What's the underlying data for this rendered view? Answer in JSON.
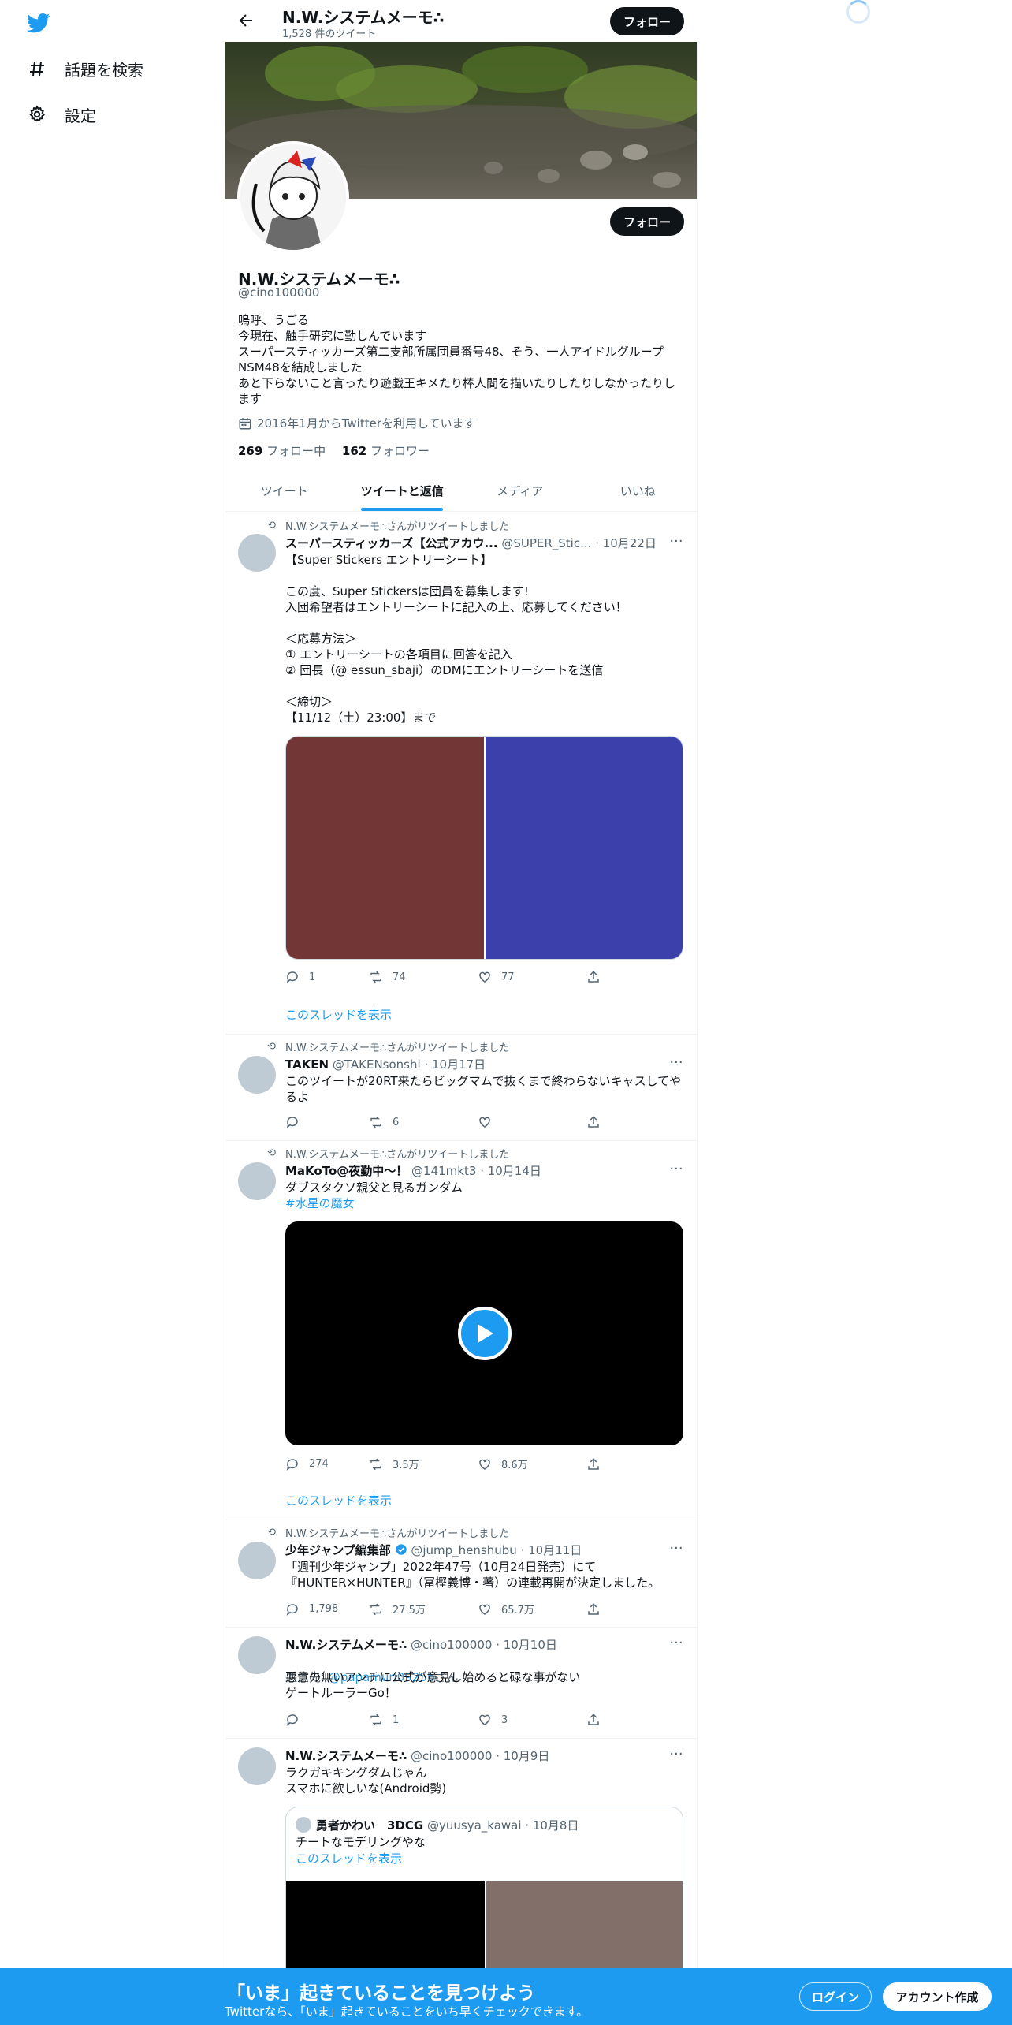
{
  "nav": {
    "explore_label": "話題を検索",
    "settings_label": "設定"
  },
  "header": {
    "name": "N.W.システムメーモ∴",
    "tweet_count": "1,528 件のツイート",
    "follow_label": "フォロー"
  },
  "profile": {
    "name": "N.W.システムメーモ∴",
    "handle": "@cino100000",
    "bio": [
      "嗚呼、うごる",
      "今現在、触手研究に勤しんでいます",
      "スーパースティッカーズ第二支部所属団員番号48、そう、一人アイドルグループNSM48を結成しました",
      "あと下らないこと言ったり遊戯王キメたり棒人間を描いたりしたりしなかったりします"
    ],
    "joined": "2016年1月からTwitterを利用しています",
    "following_count": "269",
    "following_label": "フォロー中",
    "followers_count": "162",
    "followers_label": "フォロワー",
    "follow_label": "フォロー"
  },
  "tabs": [
    {
      "label": "ツイート",
      "active": false
    },
    {
      "label": "ツイートと返信",
      "active": true
    },
    {
      "label": "メディア",
      "active": false
    },
    {
      "label": "いいね",
      "active": false
    }
  ],
  "tweets": [
    {
      "retweeted_by": "N.W.システムメーモ∴さんがリツイートしました",
      "author": "スーパースティッカーズ【公式アカウ...",
      "handle": "@SUPER_Stic...",
      "date": "· 10月22日",
      "text": "【Super Stickers エントリーシート】\n\nこの度、Super Stickersは団員を募集します!\n入団希望者はエントリーシートに記入の上、応募してください！\n\n＜応募方法＞\n① エントリーシートの各項目に回答を記入\n② 団長（@ essun_sbaji）のDMにエントリーシートを送信\n\n＜締切＞\n【11/12（土）23:00】まで",
      "media_colors": [
        "#733636",
        "#3c40aa"
      ],
      "replies": "1",
      "retweets": "74",
      "likes": "77",
      "thread_link": "このスレッドを表示"
    },
    {
      "retweeted_by": "N.W.システムメーモ∴さんがリツイートしました",
      "author": "TAKEN",
      "handle": "@TAKENsonshi",
      "date": "· 10月17日",
      "text": "このツイートが20RT来たらビッグマムで抜くまで終わらないキャスしてやるよ",
      "replies": "",
      "retweets": "6",
      "likes": ""
    },
    {
      "retweeted_by": "N.W.システムメーモ∴さんがリツイートしました",
      "author": "MaKoTo@夜勤中〜！",
      "handle": "@141mkt3",
      "date": "· 10月14日",
      "text": "ダブスタクソ親父と見るガンダム",
      "hashtag": "#水星の魔女",
      "replies": "274",
      "retweets": "3.5万",
      "likes": "8.6万",
      "thread_link": "このスレッドを表示"
    },
    {
      "retweeted_by": "N.W.システムメーモ∴さんがリツイートしました",
      "author": "少年ジャンプ編集部",
      "handle": "@jump_henshubu",
      "date": "· 10月11日",
      "text": "「週刊少年ジャンプ」2022年47号（10月24日発売）にて\n『HUNTER×HUNTER』（冨樫義博・著）の連載再開が決定しました。",
      "replies": "1,798",
      "retweets": "27.5万",
      "likes": "65.7万"
    },
    {
      "author": "N.W.システムメーモ∴",
      "handle": "@cino100000",
      "date": "· 10月10日",
      "reply_prefix": "返信先: ",
      "reply_to": "@papamuri0925b",
      "reply_suffix": "さん",
      "text": "悪意の無いアンチに公式が意見し始めると碌な事がない\nゲートルーラーGo！",
      "replies": "",
      "retweets": "1",
      "likes": "3"
    },
    {
      "author": "N.W.システムメーモ∴",
      "handle": "@cino100000",
      "date": "· 10月9日",
      "text": "ラクガキキングダムじゃん\nスマホに欲しいな(Android勢)",
      "quote": {
        "author": "勇者かわい　3DCG",
        "handle": "@yuusya_kawai",
        "date": "· 10月8日",
        "text": "チートなモデリングやな",
        "thread_link": "このスレッドを表示",
        "media_colors": [
          "#000000",
          "#836f69"
        ]
      }
    }
  ],
  "bottom_bar": {
    "title": "「いま」起きていることを見つけよう",
    "subtitle": "Twitterなら、「いま」起きていることをいち早くチェックできます。",
    "login_label": "ログイン",
    "signup_label": "アカウント作成"
  },
  "colors": {
    "accent": "#1d9bf0",
    "text": "#0f1419",
    "muted": "#536471"
  }
}
